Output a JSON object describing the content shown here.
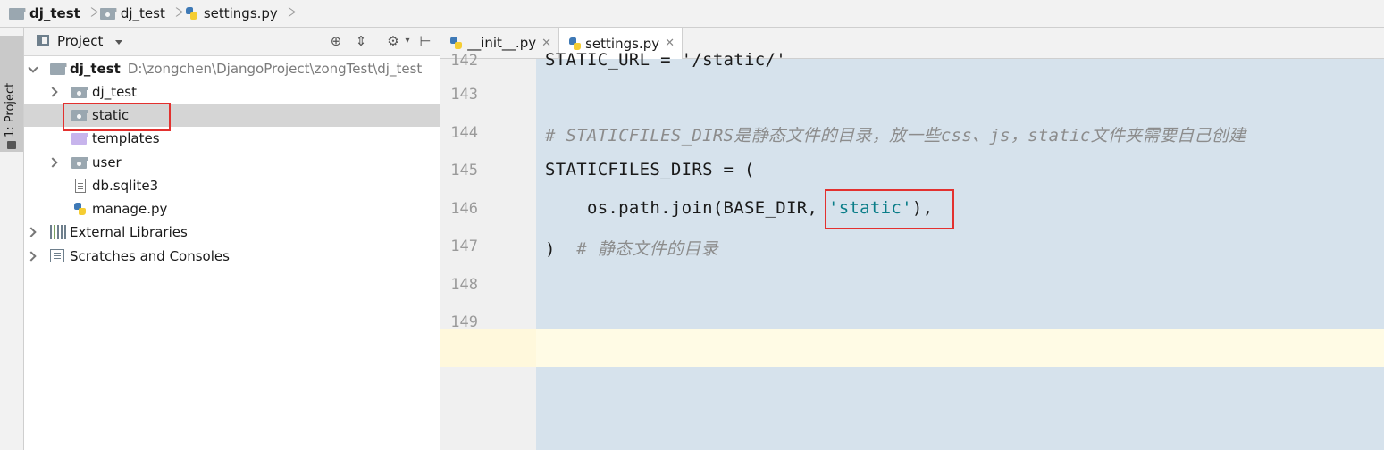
{
  "breadcrumb": {
    "items": [
      {
        "label": "dj_test",
        "icon": "folder-icon"
      },
      {
        "label": "dj_test",
        "icon": "module-folder-icon"
      },
      {
        "label": "settings.py",
        "icon": "python-file-icon"
      }
    ]
  },
  "toolstrip": {
    "project_tab_label": "1: Project"
  },
  "project_panel": {
    "title": "Project",
    "header_buttons": [
      "locate-icon",
      "collapse-icon",
      "gear-icon",
      "hide-icon"
    ],
    "tree": [
      {
        "label": "dj_test",
        "path": "D:\\zongchen\\DjangoProject\\zongTest\\dj_test",
        "expanded": true,
        "bold": true
      },
      {
        "label": "dj_test",
        "expanded": false
      },
      {
        "label": "static",
        "selected": true
      },
      {
        "label": "templates"
      },
      {
        "label": "user",
        "expanded": false
      },
      {
        "label": "db.sqlite3"
      },
      {
        "label": "manage.py"
      },
      {
        "label": "External Libraries",
        "expanded": false
      },
      {
        "label": "Scratches and Consoles",
        "expanded": false
      }
    ]
  },
  "editor": {
    "tabs": [
      {
        "label": "__init__.py",
        "active": false
      },
      {
        "label": "settings.py",
        "active": true
      }
    ],
    "lines": [
      {
        "number": "142",
        "text": "STATIC_URL = '/static/'"
      },
      {
        "number": "143",
        "text": ""
      },
      {
        "number": "144",
        "comment": "# STATICFILES_DIRS是静态文件的目录，放一些css、js，static文件夹需要自己创建"
      },
      {
        "number": "145",
        "text": "STATICFILES_DIRS = ("
      },
      {
        "number": "146",
        "code": "    os.path.join(BASE_DIR, ",
        "string": "'static'",
        "tail": "),"
      },
      {
        "number": "147",
        "text": ")  ",
        "comment": "# 静态文件的目录"
      },
      {
        "number": "148",
        "text": ""
      },
      {
        "number": "149",
        "text": ""
      }
    ]
  },
  "colors": {
    "highlight_box": "#e3312f",
    "code_bg": "#d6e2ec",
    "string": "#0a7d88",
    "comment": "#8c8c8c"
  }
}
